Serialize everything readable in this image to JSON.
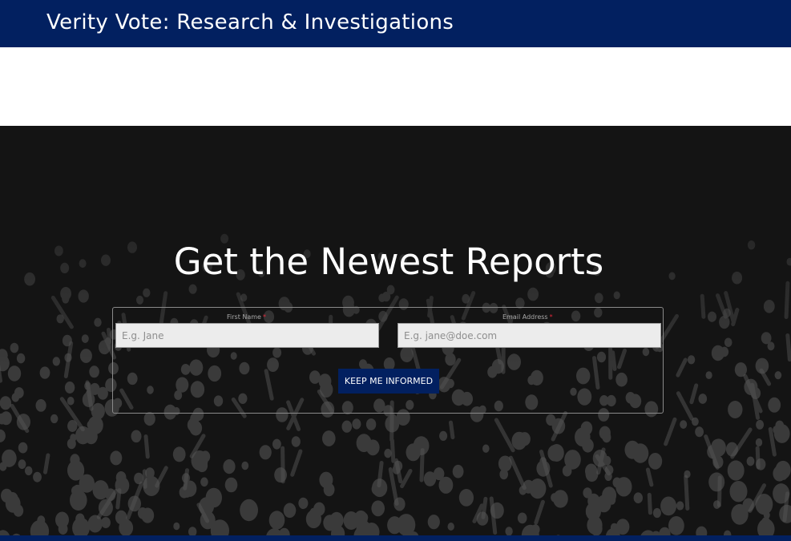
{
  "header": {
    "site_title": "Verity Vote: Research & Investigations"
  },
  "hero": {
    "title": "Get the Newest Reports"
  },
  "form": {
    "first_name": {
      "label": "First Name",
      "required_mark": "*",
      "placeholder": "E.g. Jane",
      "value": ""
    },
    "email": {
      "label": "Email Address",
      "required_mark": "*",
      "placeholder": "E.g. jane@doe.com",
      "value": ""
    },
    "submit_label": "KEEP ME INFORMED"
  },
  "colors": {
    "brand_navy": "#022060",
    "hero_background": "#141414",
    "required_red": "#e0283b"
  }
}
